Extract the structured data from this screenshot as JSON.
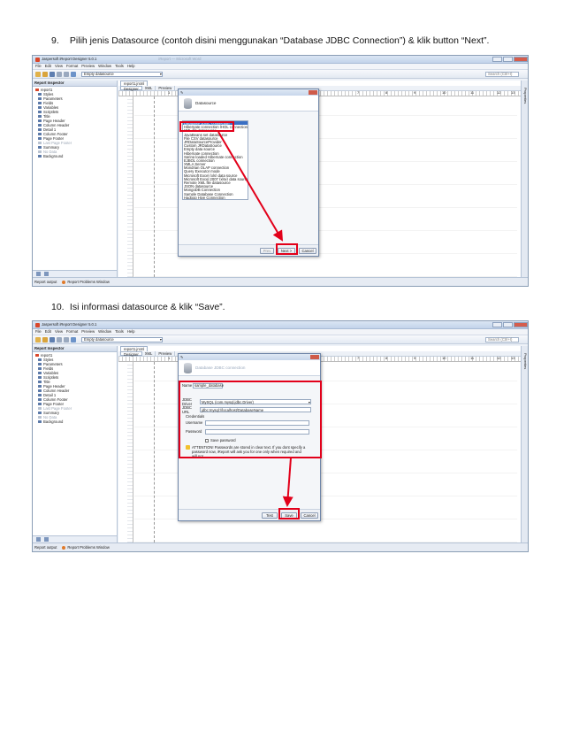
{
  "steps": [
    {
      "number": "9.",
      "text": "Pilih jenis Datasource (contoh disini menggunakan “Database JDBC Connection”) & klik button “Next”."
    },
    {
      "number": "10.",
      "text": "Isi informasi datasource & klik “Save”."
    }
  ],
  "app": {
    "window_title": "Jaspersoft iReport Designer 5.0.1",
    "window_title_blurred": "iReport — Microsoft Word",
    "menu": [
      "File",
      "Edit",
      "View",
      "Format",
      "Preview",
      "Window",
      "Tools",
      "Help"
    ],
    "datasource_select": "Empty datasource",
    "search_placeholder": "Search (Ctrl+I)",
    "report_inspector": {
      "title": "Report Inspector",
      "items": [
        "report1",
        "Styles",
        "Parameters",
        "Fields",
        "Variables",
        "Scriptlets",
        "Title",
        "Page Header",
        "Column Header",
        "Detail 1",
        "Column Footer",
        "Page Footer",
        "Last Page Footer",
        "Summary",
        "No Data",
        "Background"
      ],
      "dimmed": [
        "Last Page Footer",
        "No Data"
      ]
    },
    "doc_tab": "report1.jrxml",
    "subtabs": [
      "Designer",
      "XML",
      "Preview"
    ],
    "ruler_numbers": [
      "1",
      "2",
      "3",
      "4",
      "5",
      "6",
      "7",
      "8",
      "9",
      "10",
      "11",
      "12",
      "13",
      "14"
    ],
    "properties_label": "Properties",
    "status": [
      "Report output",
      "Report Problems Window"
    ]
  },
  "dialog1": {
    "header": "Datasource",
    "datasource_types": [
      "Database JDBC connection",
      "Hibernate connection (HQL connection)",
      "XML file datasource",
      "JavaBeans set datasource",
      "File CSV datasource",
      "JRDataSourceProvider",
      "Custom JRDataSource",
      "Empty data source",
      "Hibernate connection",
      "Spring loaded Hibernate connection",
      "EJBQL connection",
      "XMLA Server",
      "Mondrian OLAP connection",
      "Query Executor mode",
      "Microsoft Excel (xls) data source",
      "Microsoft Excel 2007 (xlsx) data source",
      "Remote XML file datasource",
      "JSON datasource",
      "MongoDB Connection",
      "Sample Database Connection",
      "Hadoop Hive Connection"
    ],
    "selected": "Database JDBC connection",
    "buttons": [
      "Prev",
      "Next >",
      "Cancel"
    ]
  },
  "dialog2": {
    "header": "Database JDBC connection",
    "name_label": "Name",
    "name_value": "sample_database",
    "driver_label": "JDBC Driver",
    "driver_value": "MySQL (com.mysql.jdbc.Driver)",
    "url_label": "JDBC URL",
    "url_value": "jdbc:mysql://localhost/DatabaseName",
    "credentials_label": "Credentials",
    "username_label": "Username",
    "password_label": "Password",
    "save_password_label": "Save password",
    "attention_text": "ATTENTION! Passwords are stored in clear text. If you dont specify a password now, iReport will ask you for one only when required and will not",
    "buttons": [
      "Test",
      "Save",
      "Cancel"
    ]
  },
  "colors": {
    "highlight": "#e2001a",
    "selection": "#3a6fc4"
  }
}
